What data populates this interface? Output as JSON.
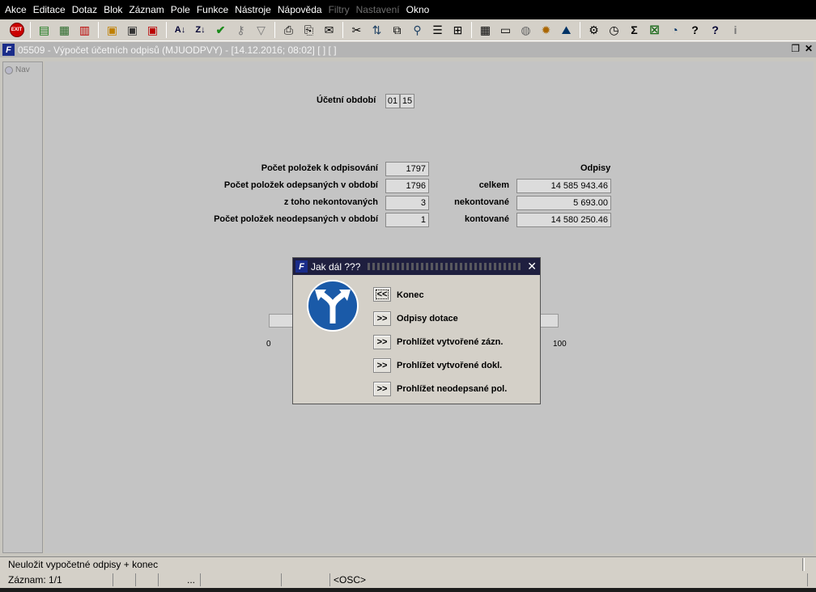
{
  "menubar": {
    "items": [
      "Akce",
      "Editace",
      "Dotaz",
      "Blok",
      "Záznam",
      "Pole",
      "Funkce",
      "Nástroje",
      "Nápověda",
      "Filtry",
      "Nastavení",
      "Okno"
    ],
    "disabled": [
      "Filtry",
      "Nastavení"
    ]
  },
  "toolbar": {
    "exit_label": "EXIT",
    "icons": [
      "exit-icon",
      "insert-record-icon",
      "save-record-icon",
      "delete-record-icon",
      "query-icon",
      "execute-query-icon",
      "cancel-query-icon",
      "sort-ascending-icon",
      "sort-descending-icon",
      "accept-icon",
      "key-icon",
      "filter-icon",
      "print-icon",
      "print-preview-icon",
      "mail-icon",
      "cut-icon",
      "copy-icon",
      "paste-icon",
      "attach-icon",
      "list-icon",
      "tree-icon",
      "calculator-icon",
      "document-icon",
      "globe-icon",
      "sun-icon",
      "chart-icon",
      "settings-icon",
      "calendar-icon",
      "sum-icon",
      "excel-icon",
      "clock-icon",
      "help-icon",
      "info-icon",
      "about-icon"
    ]
  },
  "document_window": {
    "title": "05509 - Výpočet účetních odpisů (MJUODPVY) - [14.12.2016; 08:02] [ ] [ ]",
    "nav_label": "Nav"
  },
  "form": {
    "period_label": "Účetní období",
    "period_month": "01",
    "period_year": "15",
    "odpisy_header": "Odpisy",
    "rows": [
      {
        "label": "Počet položek k odpisování",
        "value": "1797"
      },
      {
        "label": "Počet položek odepsaných v období",
        "value": "1796",
        "right_label": "celkem",
        "right_value": "14 585 943.46"
      },
      {
        "label": "z toho nekontovaných",
        "value": "3",
        "right_label": "nekontované",
        "right_value": "5 693.00"
      },
      {
        "label": "Počet položek neodepsaných v období",
        "value": "1",
        "right_label": "kontované",
        "right_value": "14 580 250.46"
      }
    ],
    "progress_min": "0",
    "progress_max": "100"
  },
  "dialog": {
    "title": "Jak dál ???",
    "close_glyph": "✕",
    "options": [
      {
        "button": "<<",
        "label": "Konec"
      },
      {
        "button": ">>",
        "label": "Odpisy dotace"
      },
      {
        "button": ">>",
        "label": "Prohlížet vytvořené zázn."
      },
      {
        "button": ">>",
        "label": "Prohlížet vytvořené dokl."
      },
      {
        "button": ">>",
        "label": "Prohlížet neodepsané pol."
      }
    ]
  },
  "status": {
    "message": "Neuložit vypočetné odpisy + konec",
    "record": "Záznam: 1/1",
    "cell2": "",
    "cell3": "",
    "cell4": "...",
    "cell5": "",
    "cell6": "",
    "mode": "<OSC>"
  },
  "colors": {
    "menubar_bg": "#000000",
    "window_bg": "#c4c4c4",
    "dialog_title_bg": "#1f1f3f",
    "sign_blue": "#1a5aa8"
  }
}
